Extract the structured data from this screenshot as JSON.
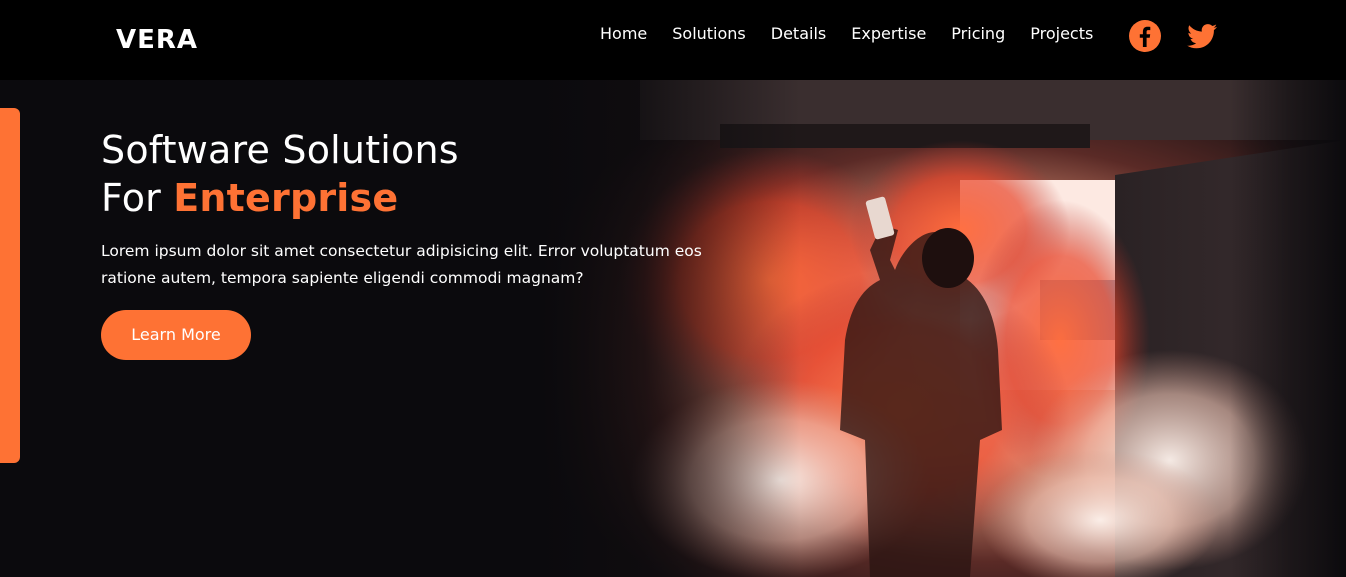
{
  "brand": {
    "logo": "VERA"
  },
  "nav": {
    "links": [
      "Home",
      "Solutions",
      "Details",
      "Expertise",
      "Pricing",
      "Projects"
    ],
    "social": [
      {
        "icon": "facebook-icon",
        "color": "#fe7234"
      },
      {
        "icon": "twitter-icon",
        "color": "#fe7234"
      }
    ]
  },
  "hero": {
    "title_line1": "Software Solutions",
    "title_line2_prefix": "For ",
    "title_line2_accent": "Enterprise",
    "description": "Lorem ipsum dolor sit amet consectetur adipisicing elit. Error voluptatum eos ratione autem, tempora sapiente eligendi commodi magnam?",
    "button_label": "Learn More",
    "image": "person-holding-orange-smoke-flare"
  },
  "colors": {
    "accent": "#fe7234",
    "navbar_bg": "#000000",
    "hero_bg": "#0b0a0d"
  }
}
